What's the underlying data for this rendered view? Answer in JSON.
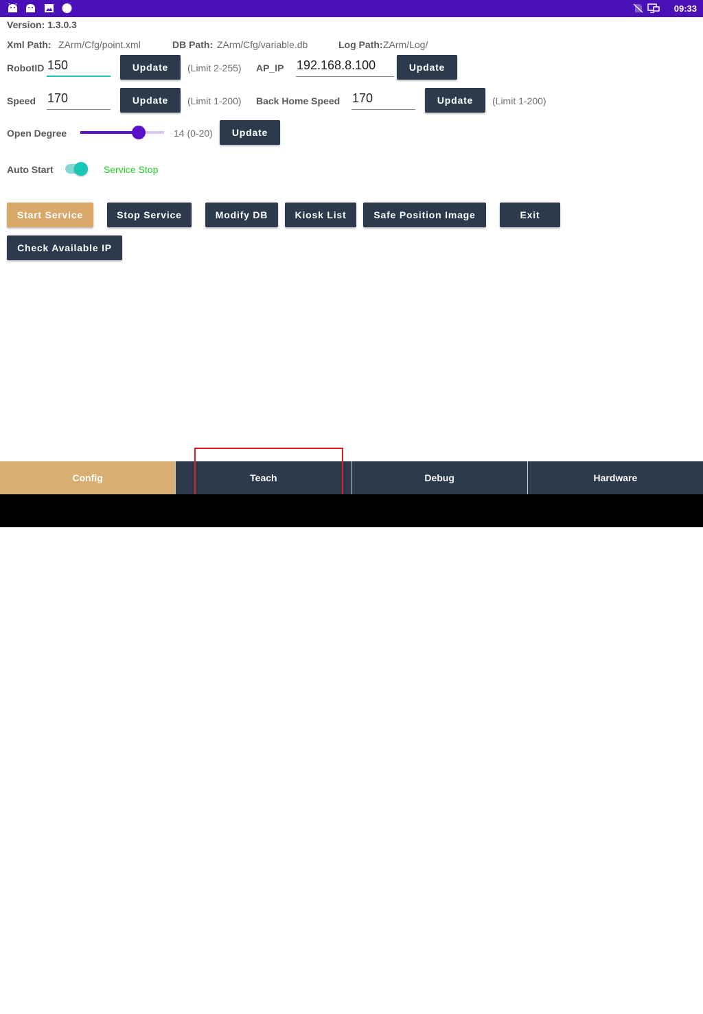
{
  "status_bar": {
    "time": "09:33"
  },
  "version_text": "Version: 1.3.0.3",
  "paths": {
    "xml_label": "Xml Path:",
    "xml_value": "ZArm/Cfg/point.xml",
    "db_label": "DB Path:",
    "db_value": "ZArm/Cfg/variable.db",
    "log_label": "Log Path:",
    "log_value": "ZArm/Log/"
  },
  "robot_id": {
    "label": "RobotID",
    "value": "150",
    "button": "Update",
    "hint": "(Limit 2-255)"
  },
  "ap_ip": {
    "label": "AP_IP",
    "value": "192.168.8.100",
    "button": "Update"
  },
  "speed": {
    "label": "Speed",
    "value": "170",
    "button": "Update",
    "hint": "(Limit 1-200)"
  },
  "back_home_speed": {
    "label": "Back Home Speed",
    "value": "170",
    "button": "Update",
    "hint": "(Limit 1-200)"
  },
  "open_degree": {
    "label": "Open Degree",
    "value": 14,
    "min": 0,
    "max": 20,
    "readout": "14 (0-20)",
    "button": "Update"
  },
  "auto_start": {
    "label": "Auto Start",
    "enabled": true,
    "service_status": "Service Stop"
  },
  "actions": {
    "start_service": "Start Service",
    "stop_service": "Stop Service",
    "modify_db": "Modify DB",
    "kiosk_list": "Kiosk List",
    "safe_position_image": "Safe Position Image",
    "exit": "Exit",
    "check_available_ip": "Check Available IP"
  },
  "tabs": [
    {
      "label": "Config",
      "active": true
    },
    {
      "label": "Teach",
      "active": false
    },
    {
      "label": "Debug",
      "active": false
    },
    {
      "label": "Hardware",
      "active": false
    }
  ],
  "colors": {
    "status_bar": "#4a10b8",
    "button": "#2c3a4c",
    "accent": "#d9a96a",
    "slider": "#5a12c8",
    "switch": "#18c7b6",
    "service_status": "#22d022",
    "highlight": "#e02020"
  },
  "icons": {
    "status_bar": [
      "android-icon",
      "android-icon",
      "image-icon",
      "circle-icon",
      "no-sim-icon",
      "screen-cast-icon"
    ],
    "nav_bar": [
      "collapse-icon",
      "power-icon",
      "screenshot-icon",
      "volume-down-icon",
      "back-icon",
      "home-icon",
      "recents-icon",
      "volume-up-icon"
    ]
  }
}
